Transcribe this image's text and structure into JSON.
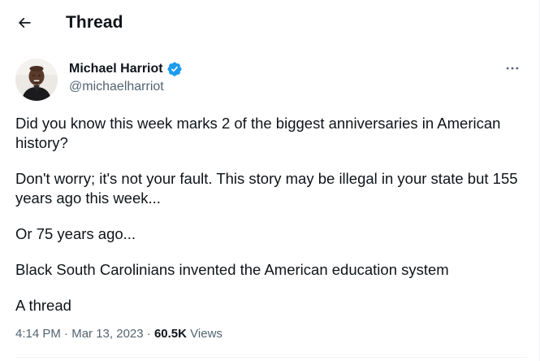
{
  "header": {
    "title": "Thread",
    "back_icon": "arrow-left-icon"
  },
  "author": {
    "name": "Michael Harriot",
    "handle": "@michaelharriot",
    "verified": true,
    "verified_color": "#1d9bf0",
    "avatar_icon": "profile-photo"
  },
  "more_icon": "more-horizontal-icon",
  "tweet": {
    "paragraphs": [
      "Did you know this week marks 2 of the biggest anniversaries in American history?",
      "Don't worry; it's not your fault. This story may be illegal in your state but 155 years ago this week...",
      "Or 75 years ago...",
      "Black South Carolinians invented the American education system",
      "A thread"
    ]
  },
  "meta": {
    "time": "4:14 PM",
    "separator": "·",
    "date": "Mar 13, 2023",
    "views_count": "60.5K",
    "views_label": "Views"
  },
  "colors": {
    "text": "#0f1419",
    "secondary": "#536471",
    "divider": "#eff3f4",
    "accent": "#1d9bf0"
  }
}
